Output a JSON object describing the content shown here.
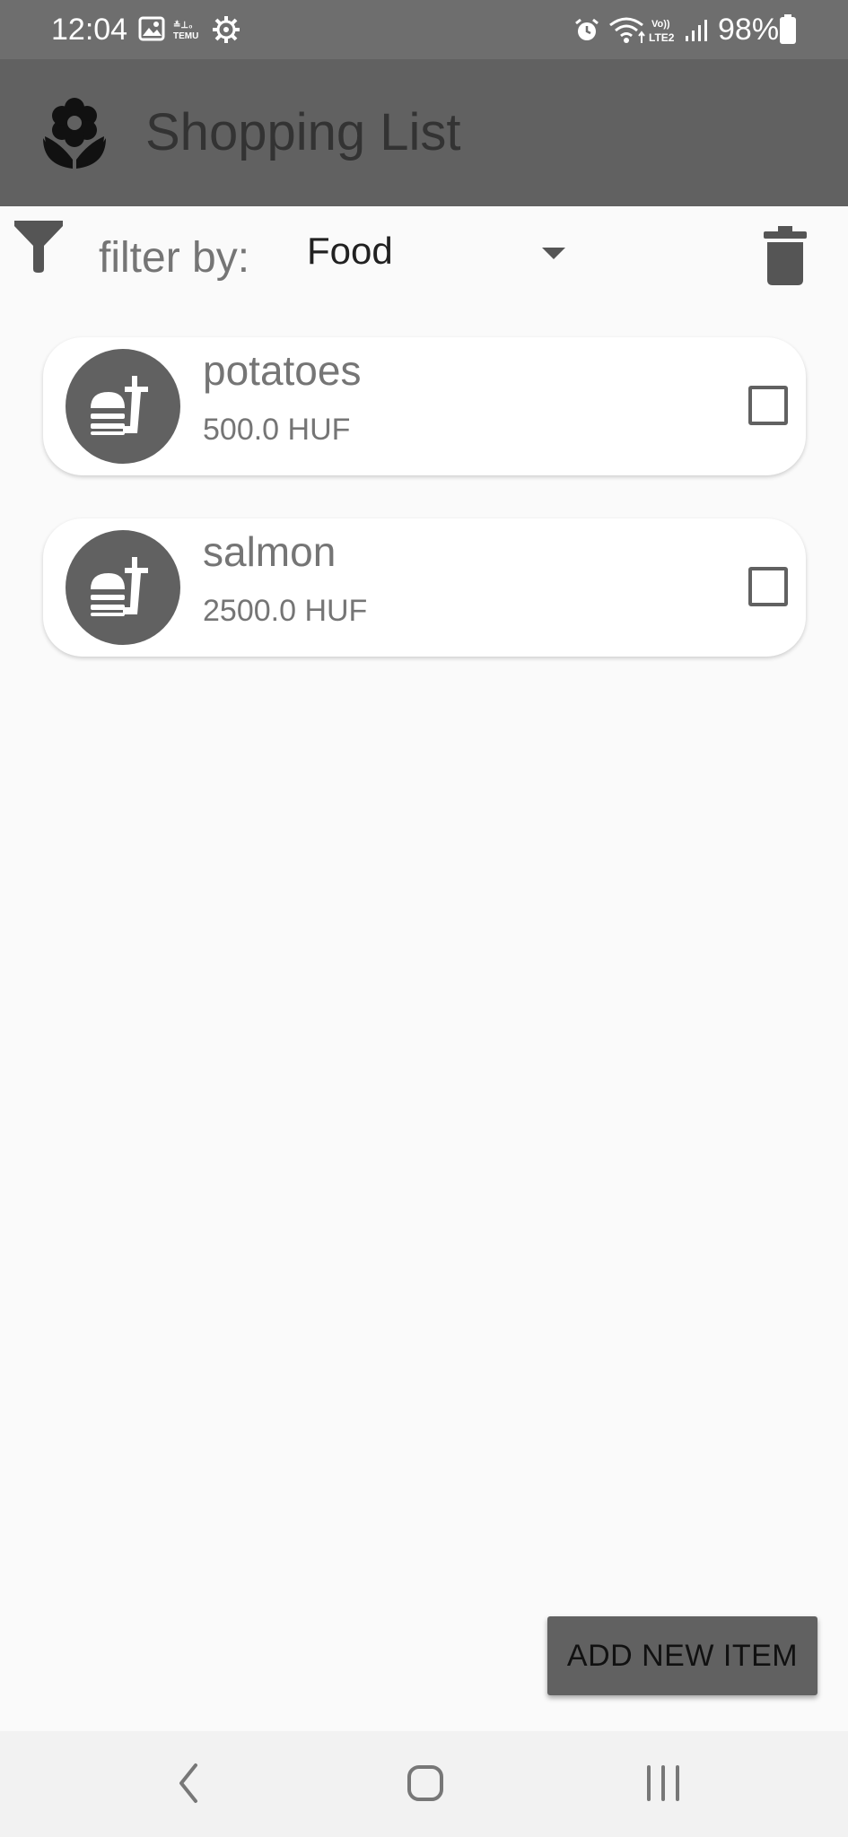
{
  "status_bar": {
    "time": "12:04",
    "battery_percent": "98%",
    "left_icons": [
      "image-icon",
      "temu-icon",
      "settings-gear-icon"
    ],
    "right_icons": [
      "alarm-icon",
      "wifi-icon",
      "volte-icon",
      "signal-icon",
      "battery-icon"
    ]
  },
  "app_bar": {
    "title": "Shopping List",
    "logo_icon": "flower-icon"
  },
  "filter": {
    "label": "filter by:",
    "selected": "Food",
    "filter_icon": "filter-icon",
    "delete_icon": "trash-icon"
  },
  "items": [
    {
      "name": "potatoes",
      "price": "500.0 HUF",
      "icon": "fastfood-icon",
      "checked": false
    },
    {
      "name": "salmon",
      "price": "2500.0 HUF",
      "icon": "fastfood-icon",
      "checked": false
    }
  ],
  "add_button": {
    "label": "ADD NEW ITEM"
  },
  "nav_bar": {
    "buttons": [
      "back-icon",
      "home-icon",
      "recents-icon"
    ]
  },
  "colors": {
    "status_bar": "#6e6e6e",
    "app_bar": "#616161",
    "background": "#fafafa",
    "accent": "#616161",
    "nav_bar": "#f2f2f2"
  }
}
